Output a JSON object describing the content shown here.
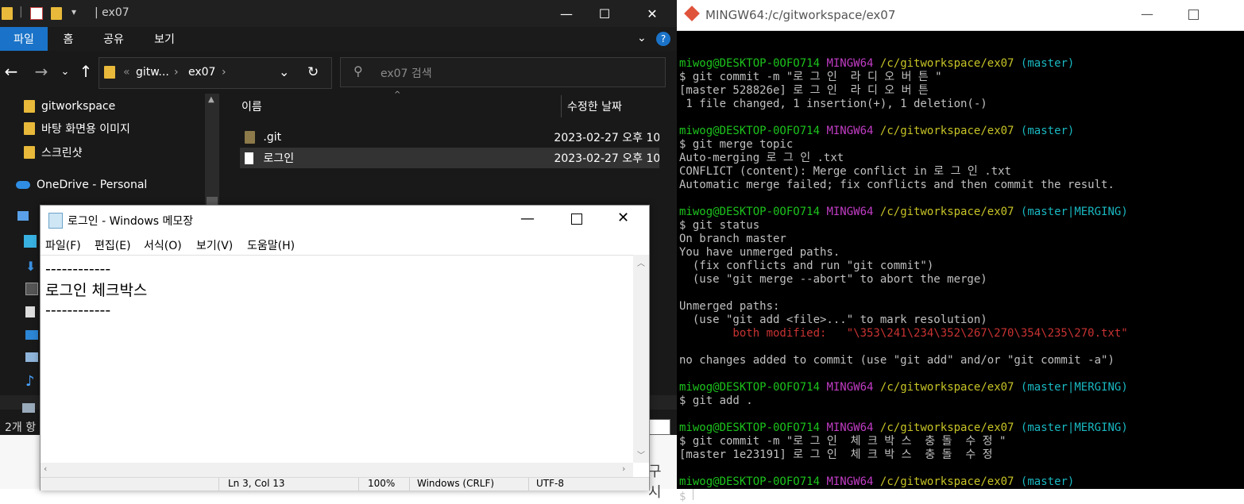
{
  "explorer": {
    "title": "| ex07",
    "ribbon_tabs": [
      "파일",
      "홈",
      "공유",
      "보기"
    ],
    "breadcrumb": {
      "root_ellipsis": "«",
      "item1": "gitw...",
      "sep": "›",
      "item2": "ex07"
    },
    "search_placeholder": "ex07 검색",
    "nav_items": [
      "gitworkspace",
      "바탕 화면용 이미지",
      "스크린샷",
      "OneDrive - Personal"
    ],
    "columns": {
      "name": "이름",
      "modified": "수정한 날짜"
    },
    "files": [
      {
        "name": ".git",
        "modified": "2023-02-27 오후 10:"
      },
      {
        "name": "로그인",
        "modified": "2023-02-27 오후 10:"
      }
    ],
    "status": "2개 항",
    "behind_text": "구 시"
  },
  "notepad": {
    "title": "로그인 - Windows 메모장",
    "menu": [
      "파일(F)",
      "편집(E)",
      "서식(O)",
      "보기(V)",
      "도움말(H)"
    ],
    "lines": [
      "------------",
      "로그인 체크박스",
      "------------"
    ],
    "status": {
      "pos": "Ln 3, Col 13",
      "zoom": "100%",
      "eol": "Windows (CRLF)",
      "enc": "UTF-8"
    }
  },
  "gitbash": {
    "title": "MINGW64:/c/gitworkspace/ex07",
    "prompt": {
      "user": "miwog@DESKTOP-0OFO714",
      "env": "MINGW64",
      "path": "/c/gitworkspace/ex07"
    },
    "blocks": [
      {
        "branch": "(master)",
        "lines": [
          "$ git commit -m \"로 그 인  라 디 오 버 튼 \"",
          "[master 528826e] 로 그 인  라 디 오 버 튼",
          " 1 file changed, 1 insertion(+), 1 deletion(-)"
        ]
      },
      {
        "branch": "(master)",
        "lines": [
          "$ git merge topic",
          "Auto-merging 로 그 인 .txt",
          "CONFLICT (content): Merge conflict in 로 그 인 .txt",
          "Automatic merge failed; fix conflicts and then commit the result."
        ]
      },
      {
        "branch": "(master|MERGING)",
        "lines": [
          "$ git status",
          "On branch master",
          "You have unmerged paths.",
          "  (fix conflicts and run \"git commit\")",
          "  (use \"git merge --abort\" to abort the merge)",
          "",
          "Unmerged paths:",
          "  (use \"git add <file>...\" to mark resolution)"
        ],
        "red_line": "        both modified:   \"\\353\\241\\234\\352\\267\\270\\354\\235\\270.txt\"",
        "after": [
          "",
          "no changes added to commit (use \"git add\" and/or \"git commit -a\")"
        ]
      },
      {
        "branch": "(master|MERGING)",
        "lines": [
          "$ git add ."
        ]
      },
      {
        "branch": "(master|MERGING)",
        "lines": [
          "$ git commit -m \"로 그 인  체 크 박 스  충 돌  수 정 \"",
          "[master 1e23191] 로 그 인  체 크 박 스  충 돌  수 정"
        ]
      },
      {
        "branch": "(master)",
        "lines": [
          "$ "
        ]
      }
    ]
  }
}
